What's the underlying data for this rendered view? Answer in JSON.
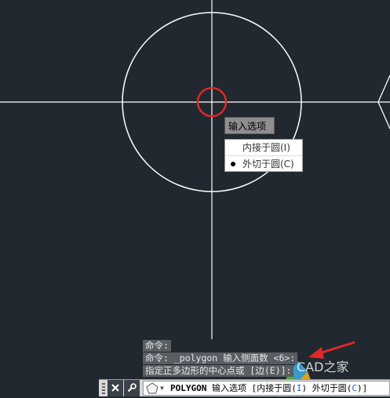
{
  "options_popup": {
    "title": "输入选项",
    "options": [
      {
        "label": "内接于圆(I)",
        "selected": false
      },
      {
        "label": "外切于圆(C)",
        "selected": true
      }
    ]
  },
  "command_history": [
    "命令:",
    "命令: _polygon 输入侧面数 <6>:",
    "指定正多边形的中心点或 [边(E)]:"
  ],
  "command_line": {
    "command": "POLYGON",
    "prompt": "输入选项",
    "bracket_open": "[",
    "option1_prefix": "内接于圆(",
    "option1_key": "I",
    "option1_suffix": ")",
    "option2_prefix": "外切于圆(",
    "option2_key": "C",
    "option2_suffix": ")",
    "bracket_close": "]"
  },
  "watermark_text": "CAD之家",
  "colors": {
    "background": "#212830",
    "crosshair": "#ffffff",
    "circle": "#ffffff",
    "pickbox": "#e02828",
    "arrow": "#e02828"
  }
}
